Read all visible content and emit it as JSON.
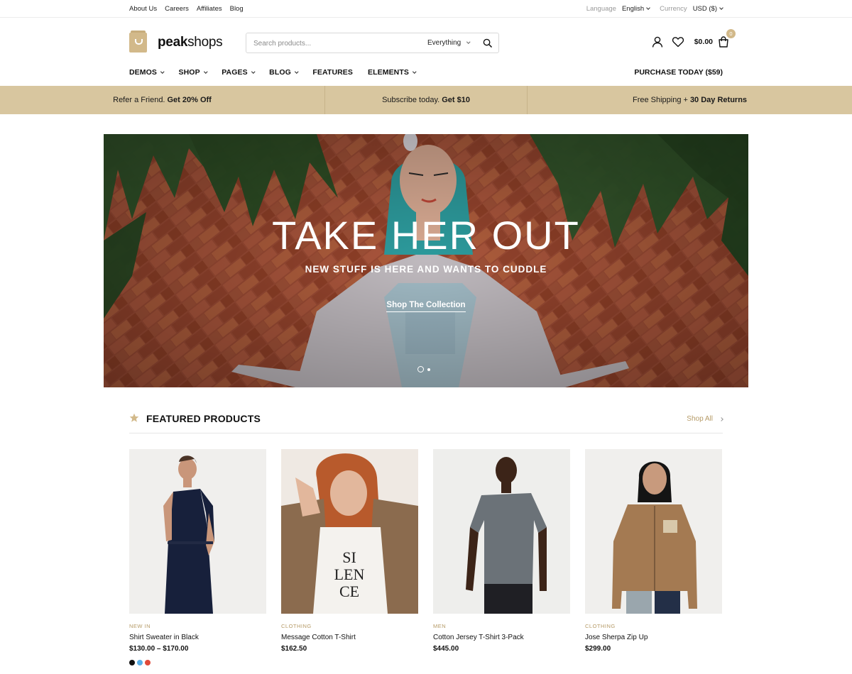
{
  "topbar": {
    "links": [
      "About Us",
      "Careers",
      "Affiliates",
      "Blog"
    ],
    "language_label": "Language",
    "language_value": "English",
    "currency_label": "Currency",
    "currency_value": "USD ($)"
  },
  "header": {
    "logo_bold": "peak",
    "logo_light": "shops",
    "search_placeholder": "Search products...",
    "search_category": "Everything",
    "cart_total": "$0.00",
    "cart_count": "0"
  },
  "nav": {
    "items": [
      "DEMOS",
      "SHOP",
      "PAGES",
      "BLOG",
      "FEATURES",
      "ELEMENTS"
    ],
    "purchase": "PURCHASE TODAY ($59)"
  },
  "promo": [
    {
      "text": "Refer a Friend.",
      "bold": "Get 20% Off"
    },
    {
      "text": "Subscribe today.",
      "bold": "Get $10"
    },
    {
      "text": "Free Shipping +",
      "bold": "30 Day Returns"
    }
  ],
  "hero": {
    "title": "TAKE HER OUT",
    "subtitle": "NEW STUFF IS HERE AND WANTS TO CUDDLE",
    "cta": "Shop The Collection"
  },
  "featured": {
    "title": "FEATURED PRODUCTS",
    "shop_all": "Shop All",
    "products": [
      {
        "category": "NEW IN",
        "name": "Shirt Sweater in Black",
        "price": "$130.00 – $170.00"
      },
      {
        "category": "CLOTHING",
        "name": "Message Cotton T-Shirt",
        "price": "$162.50"
      },
      {
        "category": "MEN",
        "name": "Cotton Jersey T-Shirt 3-Pack",
        "price": "$445.00"
      },
      {
        "category": "CLOTHING",
        "name": "Jose Sherpa Zip Up",
        "price": "$299.00"
      }
    ]
  },
  "colors": {
    "accent": "#d2b98a",
    "promo_bg": "#d8c69f",
    "swatches": [
      "#111111",
      "#5ab0e8",
      "#e04a3a"
    ]
  }
}
